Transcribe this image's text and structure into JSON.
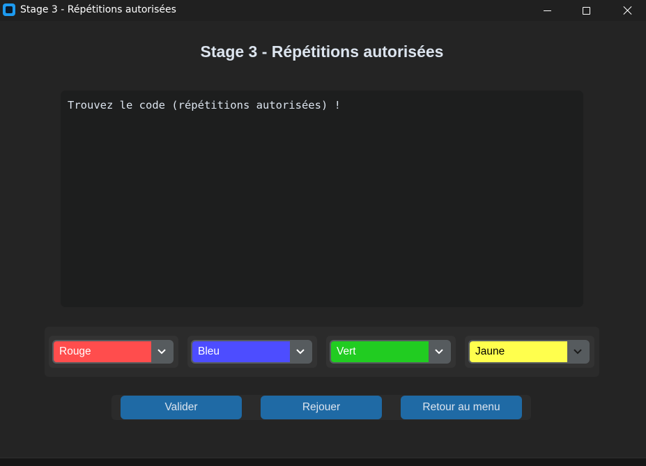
{
  "window": {
    "title": "Stage 3 - Répétitions autorisées",
    "icon": "app-icon",
    "controls": {
      "minimize": "minimize-icon",
      "maximize": "maximize-icon",
      "close": "close-icon"
    }
  },
  "main": {
    "heading": "Stage 3 - Répétitions autorisées",
    "output_text": "Trouvez le code (répétitions autorisées) !"
  },
  "color_selectors": [
    {
      "value": "Rouge",
      "color": "#ff4d4d"
    },
    {
      "value": "Bleu",
      "color": "#4d4dff"
    },
    {
      "value": "Vert",
      "color": "#21cc21"
    },
    {
      "value": "Jaune",
      "color": "#ffff4d"
    }
  ],
  "buttons": {
    "validate": "Valider",
    "replay": "Rejouer",
    "back_to_menu": "Retour au menu"
  },
  "colors": {
    "accent": "#1f6aa5",
    "background": "#242424",
    "textbox": "#1d1e1e",
    "dropdown_border": "#565b5e"
  }
}
